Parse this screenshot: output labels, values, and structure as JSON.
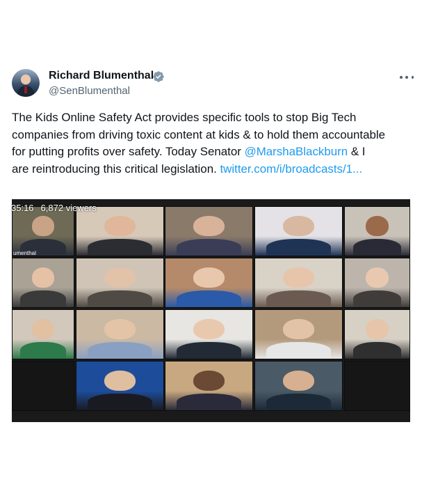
{
  "author": {
    "name": "Richard Blumenthal",
    "handle": "@SenBlumenthal"
  },
  "tweet": {
    "line1": "The Kids Online Safety Act provides specific tools to stop Big Tech",
    "line2": "companies from driving toxic content at kids & to hold them accountable",
    "line3": "for putting profits over safety. Today Senator ",
    "mention": "@MarshaBlackburn",
    "line3_end": " & I",
    "line4": "are reintroducing this critical legislation. ",
    "link": "twitter.com/i/broadcasts/1..."
  },
  "video": {
    "duration": "35:16",
    "viewers": "6,872 viewers",
    "first_tile_name": "umenthal"
  },
  "colors": {
    "link": "#1d9bf0",
    "verified": "#829aab",
    "secondary_text": "#536471"
  },
  "icons": {
    "verified": "verified-badge-icon",
    "more": "more-options-icon"
  }
}
